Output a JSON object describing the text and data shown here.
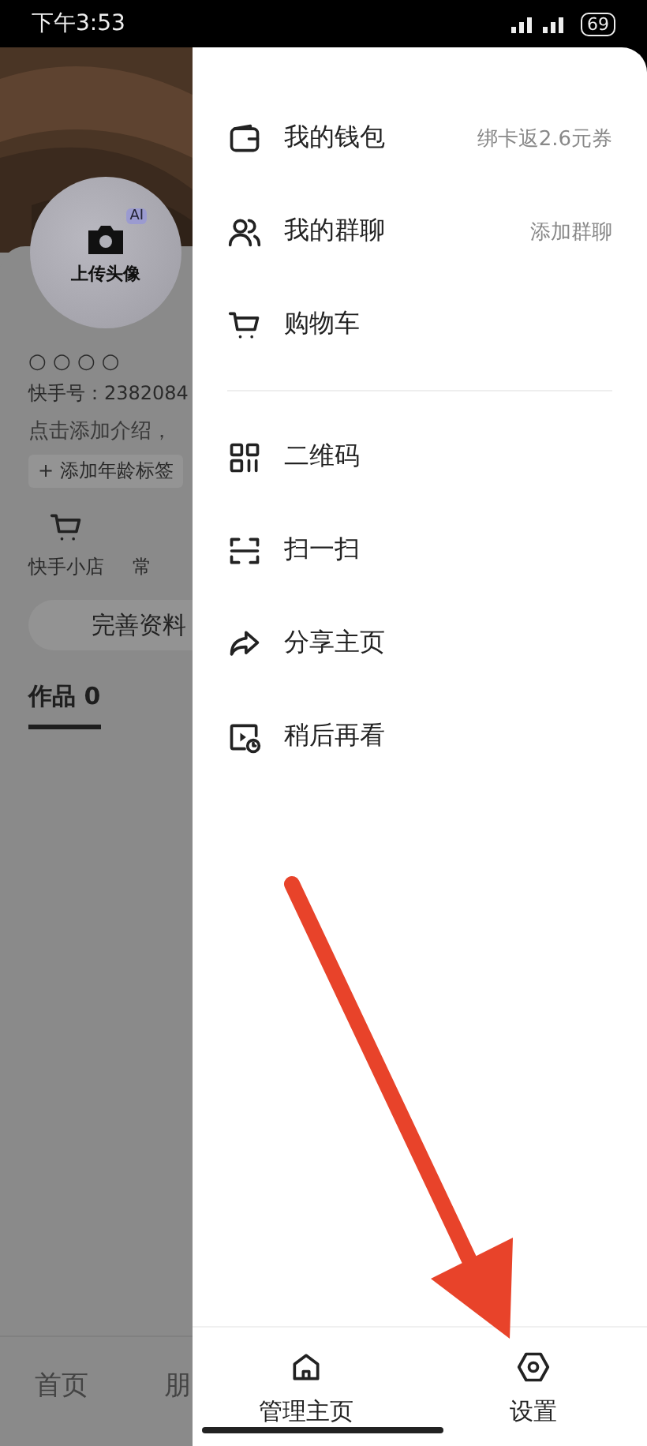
{
  "status_bar": {
    "time": "下午3:53",
    "battery": "69"
  },
  "profile": {
    "avatar_label": "上传头像",
    "avatar_badge": "AI",
    "name": "○ ○ ○ ○",
    "user_id": "快手号：2382084",
    "intro": "点击添加介绍，",
    "age_tag": "+ 添加年龄标签",
    "shortcuts": [
      {
        "label": "快手小店"
      },
      {
        "label": "常"
      }
    ],
    "edit_button": "完善资料",
    "tabs": [
      {
        "label": "作品 0",
        "selected": true
      }
    ]
  },
  "bottom_nav": [
    {
      "label": "首页"
    },
    {
      "label": "朋"
    }
  ],
  "drawer": {
    "groups": [
      [
        {
          "label": "我的钱包",
          "hint": "绑卡返2.6元券"
        },
        {
          "label": "我的群聊",
          "hint": "添加群聊"
        },
        {
          "label": "购物车"
        }
      ],
      [
        {
          "label": "二维码"
        },
        {
          "label": "扫一扫"
        },
        {
          "label": "分享主页"
        },
        {
          "label": "稍后再看"
        }
      ]
    ],
    "bottom_actions": [
      {
        "label": "管理主页"
      },
      {
        "label": "设置"
      }
    ]
  }
}
